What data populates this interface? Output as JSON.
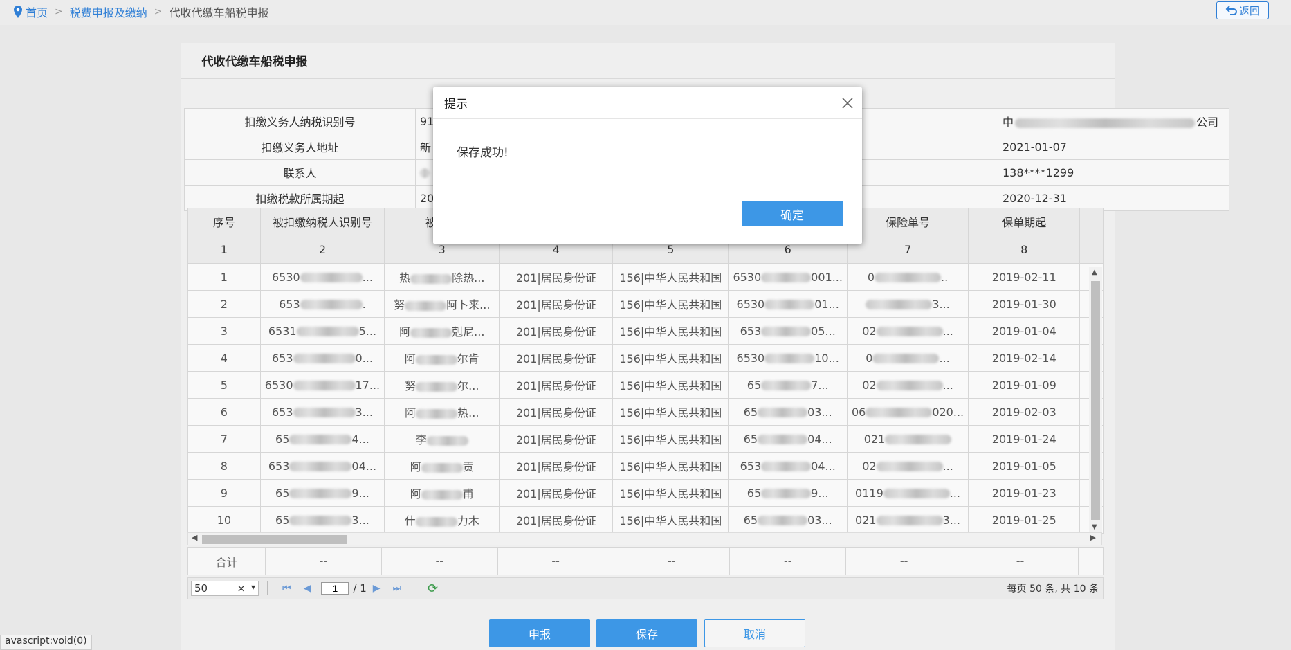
{
  "breadcrumb": {
    "home": "首页",
    "level2": "税费申报及缴纳",
    "current": "代收代缴车船税申报",
    "sep": ">"
  },
  "back_label": "返回",
  "tab_label": "代收代缴车船税申报",
  "info_rows": [
    {
      "label": "扣缴义务人纳税识别号",
      "value": "91",
      "value2": "中",
      "value2_tail": "公司"
    },
    {
      "label": "扣缴义务人地址",
      "value": "新",
      "value2": "2021-01-07"
    },
    {
      "label": "联系人",
      "value": "",
      "value2": "138****1299"
    },
    {
      "label": "扣缴税款所属期起",
      "value": "20",
      "value2": "2020-12-31"
    }
  ],
  "grid": {
    "headers": [
      "序号",
      "被扣缴纳税人识别号",
      "被扣缴",
      "",
      "",
      "",
      "保险单号",
      "保单期起"
    ],
    "index_row": [
      "1",
      "2",
      "3",
      "4",
      "5",
      "6",
      "7",
      "8"
    ],
    "rows": [
      {
        "no": "1",
        "taxid": "6530",
        "taxid_tail": "...",
        "name": "热",
        "name_tail": "除热...",
        "idtype": "201|居民身份证",
        "country": "156|中华人民共和国",
        "idno": "6530",
        "idno_tail": "001...",
        "policy": "0",
        "policy_tail": "..",
        "start": "2019-02-11"
      },
      {
        "no": "2",
        "taxid": "653",
        "taxid_tail": ".",
        "name": "努",
        "name_tail": "阿卜来...",
        "idtype": "201|居民身份证",
        "country": "156|中华人民共和国",
        "idno": "6530",
        "idno_tail": "01...",
        "policy": "",
        "policy_tail": "3...",
        "start": "2019-01-30"
      },
      {
        "no": "3",
        "taxid": "6531",
        "taxid_tail": "5...",
        "name": "阿",
        "name_tail": "剋尼...",
        "idtype": "201|居民身份证",
        "country": "156|中华人民共和国",
        "idno": "653",
        "idno_tail": "05...",
        "policy": "02",
        "policy_tail": "...",
        "start": "2019-01-04"
      },
      {
        "no": "4",
        "taxid": "653",
        "taxid_tail": "0...",
        "name": "阿",
        "name_tail": "尔肯",
        "idtype": "201|居民身份证",
        "country": "156|中华人民共和国",
        "idno": "6530",
        "idno_tail": "10...",
        "policy": "0",
        "policy_tail": "...",
        "start": "2019-02-14"
      },
      {
        "no": "5",
        "taxid": "6530",
        "taxid_tail": "17...",
        "name": "努",
        "name_tail": "尔...",
        "idtype": "201|居民身份证",
        "country": "156|中华人民共和国",
        "idno": "65",
        "idno_tail": "7...",
        "policy": "02",
        "policy_tail": "...",
        "start": "2019-01-09"
      },
      {
        "no": "6",
        "taxid": "653",
        "taxid_tail": "3...",
        "name": "阿",
        "name_tail": "热...",
        "idtype": "201|居民身份证",
        "country": "156|中华人民共和国",
        "idno": "65",
        "idno_tail": "03...",
        "policy": "06",
        "policy_tail": "020...",
        "start": "2019-02-03"
      },
      {
        "no": "7",
        "taxid": "65",
        "taxid_tail": "4...",
        "name": "李",
        "name_tail": "",
        "idtype": "201|居民身份证",
        "country": "156|中华人民共和国",
        "idno": "65",
        "idno_tail": "04...",
        "policy": "021",
        "policy_tail": "",
        "start": "2019-01-24"
      },
      {
        "no": "8",
        "taxid": "653",
        "taxid_tail": "04...",
        "name": "阿",
        "name_tail": "贡",
        "idtype": "201|居民身份证",
        "country": "156|中华人民共和国",
        "idno": "653",
        "idno_tail": "04...",
        "policy": "02",
        "policy_tail": "...",
        "start": "2019-01-05"
      },
      {
        "no": "9",
        "taxid": "65",
        "taxid_tail": "9...",
        "name": "阿",
        "name_tail": "甫",
        "idtype": "201|居民身份证",
        "country": "156|中华人民共和国",
        "idno": "65",
        "idno_tail": "9...",
        "policy": "0119",
        "policy_tail": "...",
        "start": "2019-01-23"
      },
      {
        "no": "10",
        "taxid": "65",
        "taxid_tail": "3...",
        "name": "什",
        "name_tail": "力木",
        "idtype": "201|居民身份证",
        "country": "156|中华人民共和国",
        "idno": "65",
        "idno_tail": "03...",
        "policy": "021",
        "policy_tail": "3...",
        "start": "2019-01-25"
      }
    ],
    "total_label": "合计",
    "total_dash": "--"
  },
  "pager": {
    "page_size": "50",
    "clear": "×",
    "dropdown": "▾",
    "current_page": "1",
    "total_pages": "/ 1",
    "info": "每页 50 条, 共 10 条"
  },
  "buttons": {
    "submit": "申报",
    "save": "保存",
    "cancel": "取消"
  },
  "status_url": "avascript:void(0)",
  "dialog": {
    "title": "提示",
    "message": "保存成功!",
    "ok": "确定"
  },
  "colors": {
    "accent": "#3d97e6",
    "link": "#2f7fd6"
  }
}
